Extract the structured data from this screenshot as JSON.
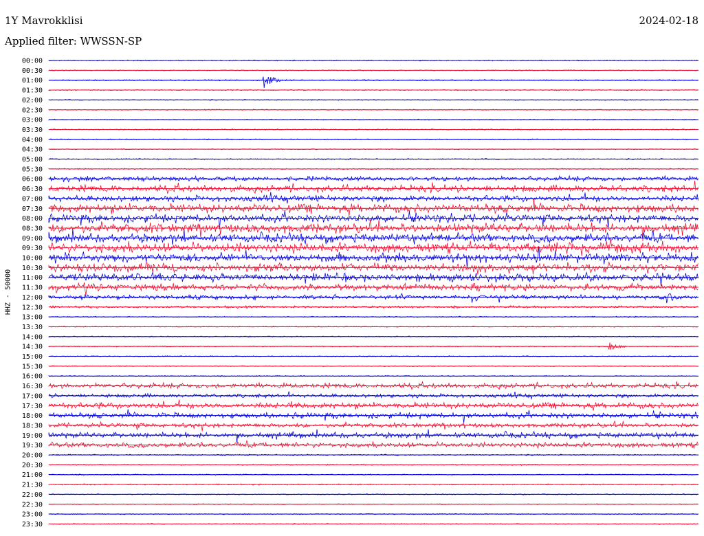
{
  "header": {
    "station": "1Y Mavrokklisi",
    "date": "2024-02-18",
    "filter": "Applied filter: WWSSN-SP"
  },
  "channel_label": "HHZ - 50000",
  "colors": {
    "trace_a": "#0000dd",
    "trace_b": "#ee1133"
  },
  "chart_data": {
    "type": "line",
    "description_kind": "helicorder",
    "rows": [
      {
        "label": "00:00",
        "color": "blue",
        "activity": 0.05
      },
      {
        "label": "00:30",
        "color": "red",
        "activity": 0.04
      },
      {
        "label": "01:00",
        "color": "blue",
        "activity": 0.08,
        "events": [
          [
            0.33,
            1.0
          ]
        ]
      },
      {
        "label": "01:30",
        "color": "red",
        "activity": 0.06
      },
      {
        "label": "02:00",
        "color": "blue",
        "activity": 0.05
      },
      {
        "label": "02:30",
        "color": "red",
        "activity": 0.05
      },
      {
        "label": "03:00",
        "color": "blue",
        "activity": 0.05
      },
      {
        "label": "03:30",
        "color": "red",
        "activity": 0.06
      },
      {
        "label": "04:00",
        "color": "blue",
        "activity": 0.05
      },
      {
        "label": "04:30",
        "color": "red",
        "activity": 0.05
      },
      {
        "label": "05:00",
        "color": "blue",
        "activity": 0.06
      },
      {
        "label": "05:30",
        "color": "red",
        "activity": 0.08
      },
      {
        "label": "06:00",
        "color": "blue",
        "activity": 0.45
      },
      {
        "label": "06:30",
        "color": "red",
        "activity": 0.7
      },
      {
        "label": "07:00",
        "color": "blue",
        "activity": 0.6
      },
      {
        "label": "07:30",
        "color": "red",
        "activity": 0.9
      },
      {
        "label": "08:00",
        "color": "blue",
        "activity": 0.8
      },
      {
        "label": "08:30",
        "color": "red",
        "activity": 1.0
      },
      {
        "label": "09:00",
        "color": "blue",
        "activity": 0.9
      },
      {
        "label": "09:30",
        "color": "red",
        "activity": 1.0
      },
      {
        "label": "10:00",
        "color": "blue",
        "activity": 0.95
      },
      {
        "label": "10:30",
        "color": "red",
        "activity": 0.9
      },
      {
        "label": "11:00",
        "color": "blue",
        "activity": 0.8
      },
      {
        "label": "11:30",
        "color": "red",
        "activity": 0.7
      },
      {
        "label": "12:00",
        "color": "blue",
        "activity": 0.4,
        "events": [
          [
            0.65,
            0.8
          ],
          [
            0.95,
            0.8
          ]
        ]
      },
      {
        "label": "12:30",
        "color": "red",
        "activity": 0.2
      },
      {
        "label": "13:00",
        "color": "blue",
        "activity": 0.06
      },
      {
        "label": "13:30",
        "color": "red",
        "activity": 0.05
      },
      {
        "label": "14:00",
        "color": "blue",
        "activity": 0.05
      },
      {
        "label": "14:30",
        "color": "red",
        "activity": 0.06,
        "events": [
          [
            0.86,
            0.7
          ]
        ]
      },
      {
        "label": "15:00",
        "color": "blue",
        "activity": 0.05
      },
      {
        "label": "15:30",
        "color": "red",
        "activity": 0.05
      },
      {
        "label": "16:00",
        "color": "blue",
        "activity": 0.05
      },
      {
        "label": "16:30",
        "color": "red",
        "activity": 0.5
      },
      {
        "label": "17:00",
        "color": "blue",
        "activity": 0.35
      },
      {
        "label": "17:30",
        "color": "red",
        "activity": 0.6
      },
      {
        "label": "18:00",
        "color": "blue",
        "activity": 0.55
      },
      {
        "label": "18:30",
        "color": "red",
        "activity": 0.45
      },
      {
        "label": "19:00",
        "color": "blue",
        "activity": 0.55
      },
      {
        "label": "19:30",
        "color": "red",
        "activity": 0.5
      },
      {
        "label": "20:00",
        "color": "blue",
        "activity": 0.08
      },
      {
        "label": "20:30",
        "color": "red",
        "activity": 0.07
      },
      {
        "label": "21:00",
        "color": "blue",
        "activity": 0.06
      },
      {
        "label": "21:30",
        "color": "red",
        "activity": 0.08
      },
      {
        "label": "22:00",
        "color": "blue",
        "activity": 0.05
      },
      {
        "label": "22:30",
        "color": "red",
        "activity": 0.05
      },
      {
        "label": "23:00",
        "color": "blue",
        "activity": 0.05
      },
      {
        "label": "23:30",
        "color": "red",
        "activity": 0.05
      }
    ]
  }
}
